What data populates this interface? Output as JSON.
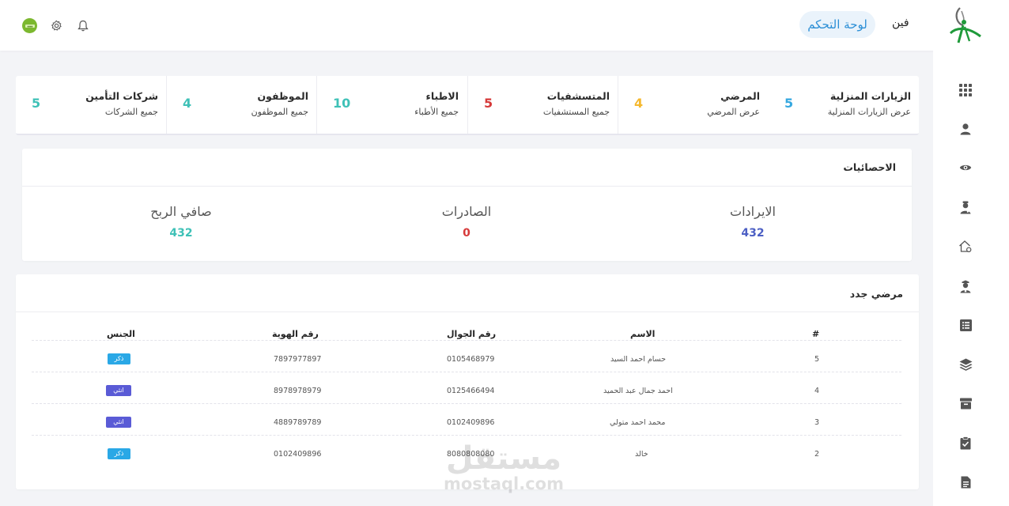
{
  "header": {
    "brand": "فين",
    "dashboard_label": "لوحة التحكم"
  },
  "icons": {
    "notifications": "bell-icon",
    "settings": "gear-icon",
    "avatar": "avatar-icon"
  },
  "sidebar": {
    "items": [
      {
        "icon": "grid-icon"
      },
      {
        "icon": "user-icon"
      },
      {
        "icon": "eye-icon"
      },
      {
        "icon": "doctor-icon"
      },
      {
        "icon": "home-icon"
      },
      {
        "icon": "nurse-icon"
      },
      {
        "icon": "list-icon"
      },
      {
        "icon": "layers-icon"
      },
      {
        "icon": "archive-icon"
      },
      {
        "icon": "clipboard-check-icon"
      },
      {
        "icon": "document-icon"
      }
    ]
  },
  "stats": [
    {
      "title": "الزيارات المنزلية",
      "subtitle": "عرض الزيارات المنزلية",
      "value": "5",
      "color": "#35a8e0"
    },
    {
      "title": "المرضي",
      "subtitle": "عرض المرضي",
      "value": "4",
      "color": "#f5b82e"
    },
    {
      "title": "المتسشفيات",
      "subtitle": "جميع المستشفيات",
      "value": "5",
      "color": "#d63a3a"
    },
    {
      "title": "الاطباء",
      "subtitle": "جميع الأطباء",
      "value": "10",
      "color": "#3fc1b7"
    },
    {
      "title": "الموظفون",
      "subtitle": "جميع الموظفون",
      "value": "4",
      "color": "#3fc1b7"
    },
    {
      "title": "شركات التأمين",
      "subtitle": "جميع الشركات",
      "value": "5",
      "color": "#3fc1b7"
    }
  ],
  "statistics": {
    "title": "الاحصائيات",
    "revenue_label": "الايرادات",
    "revenue_value": "432",
    "expenses_label": "الصادرات",
    "expenses_value": "0",
    "profit_label": "صافي الربح",
    "profit_value": "432"
  },
  "patients": {
    "title": "مرضي جدد",
    "columns": [
      "#",
      "الاسم",
      "رقم الجوال",
      "رقم الهوية",
      "الجنس"
    ],
    "rows": [
      {
        "num": "5",
        "name": "حسام احمد السيد",
        "phone": "0105468979",
        "id": "7897977897",
        "gender": "ذكر",
        "gender_color": "#2aa8e6"
      },
      {
        "num": "4",
        "name": "احمد جمال عبد الحميد",
        "phone": "0125466494",
        "id": "8978978979",
        "gender": "انثي",
        "gender_color": "#5a5bd6"
      },
      {
        "num": "3",
        "name": "محمد احمد متولي",
        "phone": "0102409896",
        "id": "4889789789",
        "gender": "انثي",
        "gender_color": "#5a5bd6"
      },
      {
        "num": "2",
        "name": "خالد",
        "phone": "8080808080",
        "id": "0102409896",
        "gender": "ذكر",
        "gender_color": "#2aa8e6"
      }
    ]
  },
  "watermark": {
    "arabic": "مستقل",
    "latin": "mostaql.com"
  }
}
